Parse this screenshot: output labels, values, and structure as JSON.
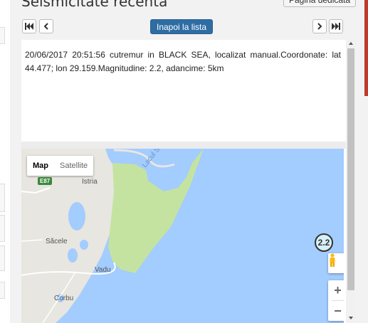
{
  "header": {
    "title": "Seismicitate recenta",
    "dedicated_page_button": "Pagina dedicata"
  },
  "nav": {
    "back_to_list": "Inapoi la lista",
    "first_icon": "first-page-icon",
    "prev_icon": "chevron-left-icon",
    "next_icon": "chevron-right-icon",
    "last_icon": "last-page-icon"
  },
  "event": {
    "description": "20/06/2017 20:51:56 cutremur in BLACK SEA, localizat manual.Coordonate: lat 44.477; lon 29.159.Magnitudine: 2.2, adancime: 5km"
  },
  "map": {
    "type_map": "Map",
    "type_satellite": "Satellite",
    "selected_type": "Map",
    "marker_magnitude": "2.2",
    "places": {
      "istria": "Istria",
      "sacele": "Săcele",
      "vadu": "Vadu",
      "corbu": "Corbu",
      "lake": "Lacul Sinoe",
      "road": "E87"
    },
    "zoom_in": "+",
    "zoom_out": "−",
    "colors": {
      "sea": "#a3ccff",
      "land": "#e8e6e0",
      "wetland": "#c5e3a0",
      "marker": "#d8f0fa"
    }
  },
  "colors": {
    "primary_button": "#2e6da4",
    "accent": "#c0392b"
  }
}
